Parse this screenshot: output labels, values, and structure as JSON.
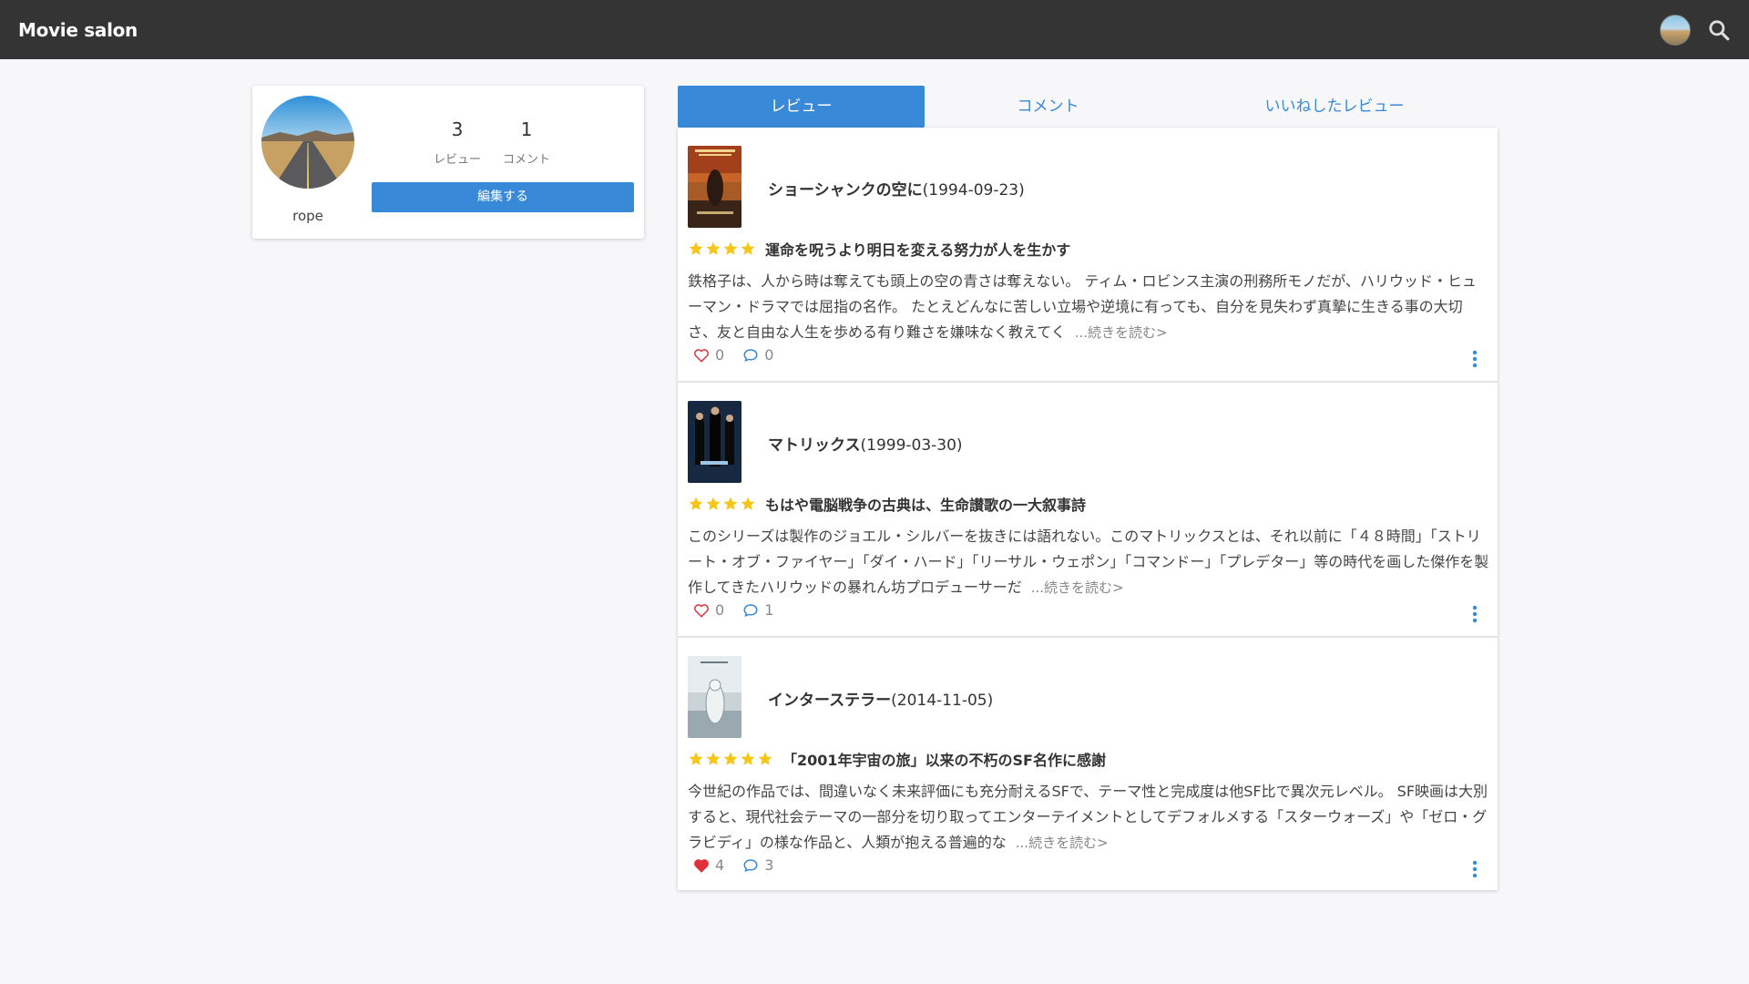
{
  "app": {
    "title": "Movie salon"
  },
  "profile": {
    "username": "rope",
    "stats": [
      {
        "value": "3",
        "label": "レビュー"
      },
      {
        "value": "1",
        "label": "コメント"
      }
    ],
    "edit_label": "編集する"
  },
  "tabs": [
    {
      "label": "レビュー",
      "active": true
    },
    {
      "label": "コメント",
      "active": false
    },
    {
      "label": "いいねしたレビュー",
      "active": false
    }
  ],
  "reviews": [
    {
      "movie_title": "ショーシャンクの空に",
      "release_date": "(1994-09-23)",
      "rating": 4,
      "headline": "運命を呪うより明日を変える努力が人を生かす",
      "body": "鉄格子は、人から時は奪えても頭上の空の青さは奪えない。 ティム・ロビンス主演の刑務所モノだが、ハリウッド・ヒューマン・ドラマでは屈指の名作。 たとえどんなに苦しい立場や逆境に有っても、自分を見失わず真摯に生きる事の大切さ、友と自由な人生を歩める有り難さを嫌味なく教えてく",
      "read_more": "...続きを読む>",
      "likes": "0",
      "liked": false,
      "comments": "0"
    },
    {
      "movie_title": "マトリックス",
      "release_date": "(1999-03-30)",
      "rating": 4,
      "headline": "もはや電脳戦争の古典は、生命讃歌の一大叙事詩",
      "body": "このシリーズは製作のジョエル・シルバーを抜きには語れない。このマトリックスとは、それ以前に「４８時間」「ストリート・オブ・ファイヤー」「ダイ・ハード」「リーサル・ウェポン」「コマンドー」「プレデター」等の時代を画した傑作を製作してきたハリウッドの暴れん坊プロデューサーだ",
      "read_more": "...続きを読む>",
      "likes": "0",
      "liked": false,
      "comments": "1"
    },
    {
      "movie_title": "インターステラー",
      "release_date": "(2014-11-05)",
      "rating": 5,
      "headline": "「2001年宇宙の旅」以来の不朽のSF名作に感謝",
      "body": "今世紀の作品では、間違いなく未来評価にも充分耐えるSFで、テーマ性と完成度は他SF比で異次元レベル。 SF映画は大別すると、現代社会テーマの一部分を切り取ってエンターテイメントとしてデフォルメする「スターウォーズ」や「ゼロ・グラビディ」の様な作品と、人類が抱える普遍的な",
      "read_more": "...続きを読む>",
      "likes": "4",
      "liked": true,
      "comments": "3"
    }
  ],
  "colors": {
    "accent": "#3889d8",
    "topbar": "#343434",
    "star": "#f5c518",
    "heart": "#e0303a",
    "comment": "#3889d8"
  }
}
